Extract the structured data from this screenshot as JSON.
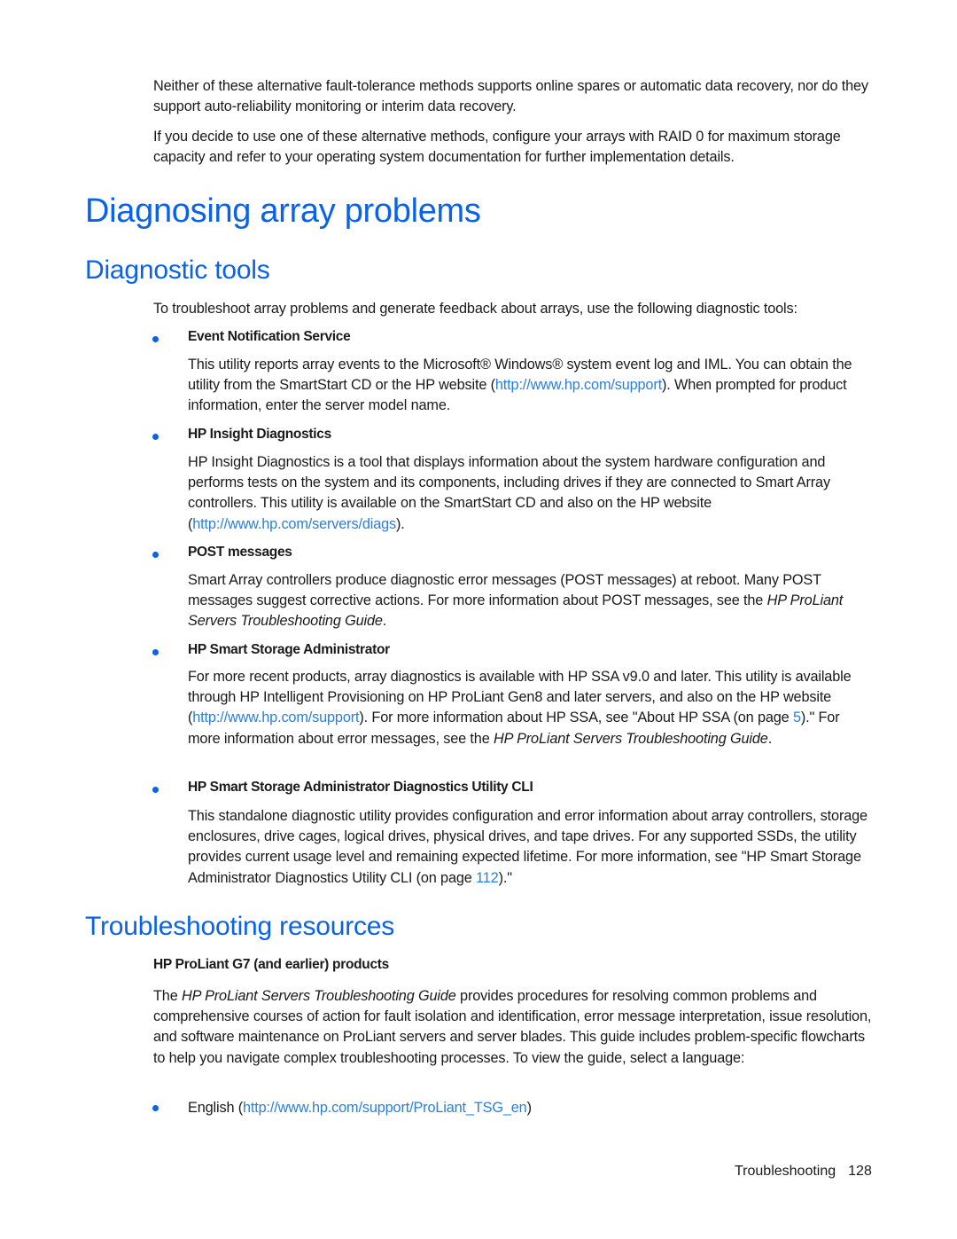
{
  "intro": {
    "p1": "Neither of these alternative fault-tolerance methods supports online spares or automatic data recovery, nor do they support auto-reliability monitoring or interim data recovery.",
    "p2": "If you decide to use one of these alternative methods, configure your arrays with RAID 0 for maximum storage capacity and refer to your operating system documentation for further implementation details."
  },
  "heading_main": "Diagnosing array problems",
  "diagnostic_tools": {
    "heading": "Diagnostic tools",
    "intro": "To troubleshoot array problems and generate feedback about arrays, use the following diagnostic tools:",
    "items": [
      {
        "title": "Event Notification Service",
        "text_before": "This utility reports array events to the Microsoft® Windows® system event log and IML. You can obtain the utility from the SmartStart CD or the HP website (",
        "link": "http://www.hp.com/support",
        "text_after": "). When prompted for product information, enter the server model name."
      },
      {
        "title": "HP Insight Diagnostics",
        "text_before": "HP Insight Diagnostics is a tool that displays information about the system hardware configuration and performs tests on the system and its components, including drives if they are connected to Smart Array controllers. This utility is available on the SmartStart CD and also on the HP website (",
        "link": "http://www.hp.com/servers/diags",
        "text_after": ")."
      },
      {
        "title": "POST messages",
        "text_before": "Smart Array controllers produce diagnostic error messages (POST messages) at reboot. Many POST messages suggest corrective actions. For more information about POST messages, see the ",
        "italic": "HP ProLiant Servers Troubleshooting Guide",
        "text_after": "."
      },
      {
        "title": "HP Smart Storage Administrator",
        "text_before": "For more recent products, array diagnostics is available with HP SSA v9.0 and later. This utility is available through HP Intelligent Provisioning on HP ProLiant Gen8 and later servers, and also on the HP website (",
        "link": "http://www.hp.com/support",
        "text_mid": "). For more information about HP SSA, see \"About HP SSA (on page ",
        "page_link": "5",
        "text_mid2": ").\" For more information about error messages, see the ",
        "italic": "HP ProLiant Servers Troubleshooting Guide",
        "text_after": "."
      },
      {
        "title": "HP Smart Storage Administrator Diagnostics Utility CLI",
        "text_before": "This standalone diagnostic utility provides configuration and error information about array controllers, storage enclosures, drive cages, logical drives, physical drives, and tape drives. For any supported SSDs, the utility provides current usage level and remaining expected lifetime. For more information, see \"HP Smart Storage Administrator Diagnostics Utility CLI (on page ",
        "page_link": "112",
        "text_after": ").\""
      }
    ]
  },
  "troubleshooting_resources": {
    "heading": "Troubleshooting resources",
    "subheading": "HP ProLiant G7 (and earlier) products",
    "para_prefix": "The ",
    "para_italic": "HP ProLiant Servers Troubleshooting Guide",
    "para_rest": " provides procedures for resolving common problems and comprehensive courses of action for fault isolation and identification, error message interpretation, issue resolution, and software maintenance on ProLiant servers and server blades. This guide includes problem-specific flowcharts to help you navigate complex troubleshooting processes. To view the guide, select a language:",
    "languages": [
      {
        "label": "English (",
        "link": "http://www.hp.com/support/ProLiant_TSG_en",
        "suffix": ")"
      }
    ]
  },
  "footer": {
    "section": "Troubleshooting",
    "page_number": "128"
  },
  "colors": {
    "heading": "#0a63e6",
    "link": "#2b7fdc",
    "bullet": "#0a63e6"
  }
}
